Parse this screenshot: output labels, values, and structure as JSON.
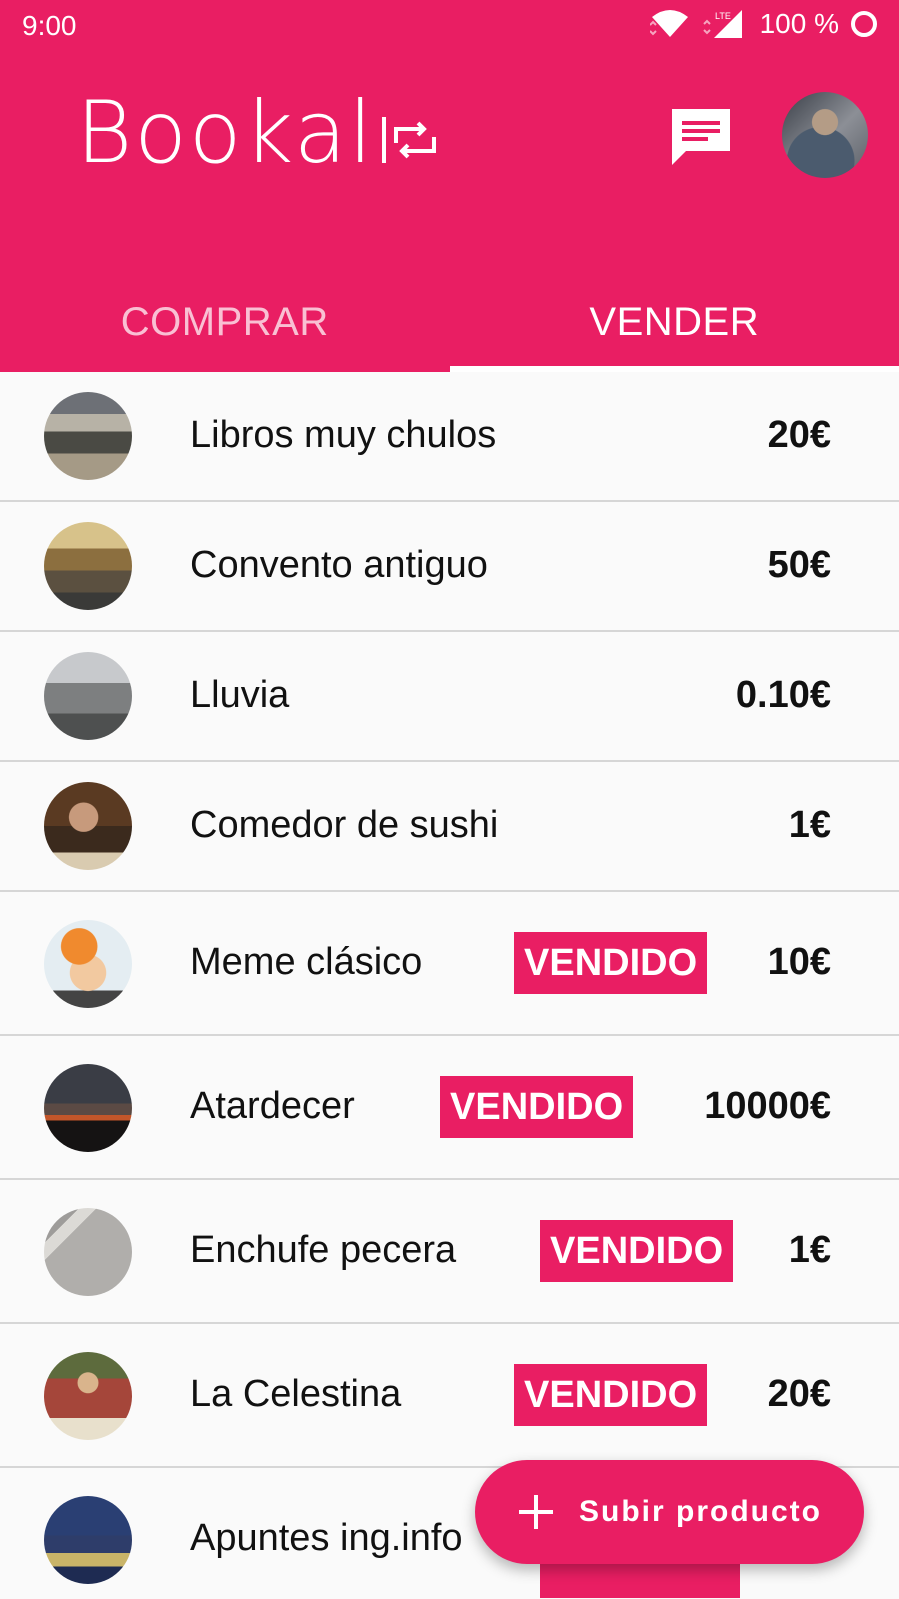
{
  "status_bar": {
    "time": "9:00",
    "network": "LTE",
    "battery": "100 %",
    "icons": [
      "wifi-icon",
      "signal-icon",
      "battery-ring-icon"
    ]
  },
  "app_bar": {
    "logo_text": "Bookal",
    "chat_icon": "chat-message-icon",
    "avatar_icon": "user-avatar"
  },
  "tabs": [
    {
      "label": "COMPRAR",
      "active": false
    },
    {
      "label": "VENDER",
      "active": true
    }
  ],
  "products": [
    {
      "title": "Libros muy chulos",
      "price": "20€",
      "sold": false,
      "sold_label": ""
    },
    {
      "title": "Convento antiguo",
      "price": "50€",
      "sold": false,
      "sold_label": ""
    },
    {
      "title": "Lluvia",
      "price": "0.10€",
      "sold": false,
      "sold_label": ""
    },
    {
      "title": "Comedor de sushi",
      "price": "1€",
      "sold": false,
      "sold_label": ""
    },
    {
      "title": "Meme clásico",
      "price": "10€",
      "sold": true,
      "sold_label": "VENDIDO"
    },
    {
      "title": "Atardecer",
      "price": "10000€",
      "sold": true,
      "sold_label": "VENDIDO"
    },
    {
      "title": "Enchufe pecera",
      "price": "1€",
      "sold": true,
      "sold_label": "VENDIDO"
    },
    {
      "title": "La Celestina",
      "price": "20€",
      "sold": true,
      "sold_label": "VENDIDO"
    },
    {
      "title": "Apuntes ing.info",
      "price": "",
      "sold": true,
      "sold_label": ""
    }
  ],
  "fab": {
    "label": "Subir producto",
    "icon": "plus-icon"
  },
  "colors": {
    "primary": "#e91e63",
    "background": "#fafafa",
    "divider": "#d6d6d6",
    "text": "#111111"
  }
}
